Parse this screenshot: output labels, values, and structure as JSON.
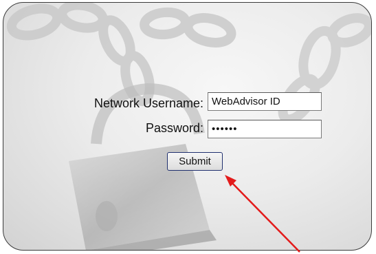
{
  "login_form": {
    "username_label": "Network Username:",
    "username_value": "WebAdvisor ID",
    "password_label": "Password:",
    "password_value": "••••••",
    "submit_label": "Submit"
  },
  "background": {
    "image": "chain-and-padlock",
    "panel_color": "#e8e8e8"
  },
  "annotation": {
    "arrow_color": "#e31b1b",
    "points_to": "submit-button"
  }
}
